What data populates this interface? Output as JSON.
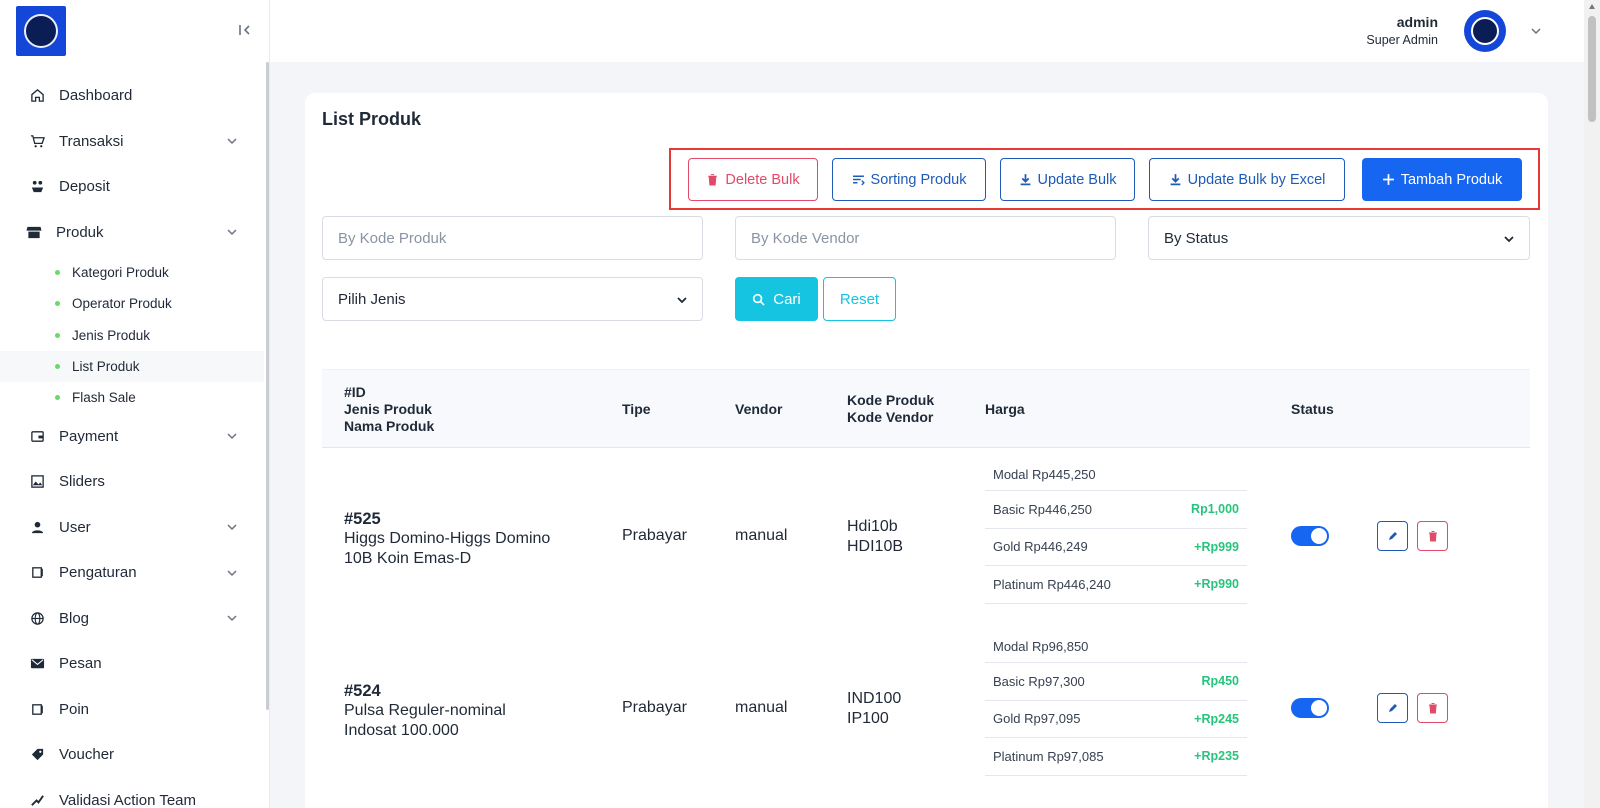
{
  "sidebar": {
    "items": [
      {
        "label": "Dashboard",
        "icon": "home-icon"
      },
      {
        "label": "Transaksi",
        "icon": "cart-icon"
      },
      {
        "label": "Deposit",
        "icon": "deposit-icon"
      },
      {
        "label": "Produk",
        "icon": "store-icon"
      },
      {
        "label": "Payment",
        "icon": "wallet-icon"
      },
      {
        "label": "Sliders",
        "icon": "image-icon"
      },
      {
        "label": "User",
        "icon": "user-icon"
      },
      {
        "label": "Pengaturan",
        "icon": "settings-icon"
      },
      {
        "label": "Blog",
        "icon": "globe-icon"
      },
      {
        "label": "Pesan",
        "icon": "mail-icon"
      },
      {
        "label": "Poin",
        "icon": "points-icon"
      },
      {
        "label": "Voucher",
        "icon": "tag-icon"
      },
      {
        "label": "Validasi Action Team",
        "icon": "check-icon"
      }
    ],
    "produk_sub": [
      "Kategori Produk",
      "Operator Produk",
      "Jenis Produk",
      "List Produk",
      "Flash Sale"
    ]
  },
  "header": {
    "user_name": "admin",
    "user_role": "Super Admin"
  },
  "page": {
    "title": "List Produk"
  },
  "toolbar": {
    "delete_bulk": "Delete Bulk",
    "sorting": "Sorting Produk",
    "update_bulk": "Update Bulk",
    "update_excel": "Update Bulk by Excel",
    "add": "Tambah Produk"
  },
  "filters": {
    "kode_produk_placeholder": "By Kode Produk",
    "kode_vendor_placeholder": "By Kode Vendor",
    "status_value": "By Status",
    "jenis_value": "Pilih Jenis",
    "cari": "Cari",
    "reset": "Reset"
  },
  "table": {
    "headers": {
      "id": "#ID",
      "jenis": "Jenis Produk",
      "nama": "Nama Produk",
      "tipe": "Tipe",
      "vendor": "Vendor",
      "kode_produk": "Kode Produk",
      "kode_vendor": "Kode Vendor",
      "harga": "Harga",
      "status": "Status"
    },
    "rows": [
      {
        "id": "#525",
        "name_line1": "Higgs Domino-Higgs Domino",
        "name_line2": "10B Koin Emas-D",
        "tipe": "Prabayar",
        "vendor": "manual",
        "kode_produk": "Hdi10b",
        "kode_vendor": "HDI10B",
        "modal": "Modal Rp445,250",
        "basic": "Basic Rp446,250",
        "basic_gain": "Rp1,000",
        "gold": "Gold Rp446,249",
        "gold_gain": "+Rp999",
        "platinum": "Platinum Rp446,240",
        "platinum_gain": "+Rp990",
        "status_on": true
      },
      {
        "id": "#524",
        "name_line1": "Pulsa Reguler-nominal",
        "name_line2": "Indosat 100.000",
        "tipe": "Prabayar",
        "vendor": "manual",
        "kode_produk": "IND100",
        "kode_vendor": "IP100",
        "modal": "Modal Rp96,850",
        "basic": "Basic Rp97,300",
        "basic_gain": "Rp450",
        "gold": "Gold Rp97,095",
        "gold_gain": "+Rp245",
        "platinum": "Platinum Rp97,085",
        "platinum_gain": "+Rp235",
        "status_on": true
      }
    ]
  }
}
